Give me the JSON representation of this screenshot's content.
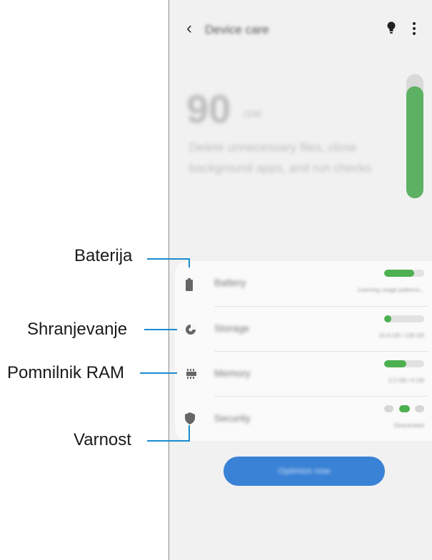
{
  "screen": {
    "title": "Device care",
    "score": "90",
    "score_unit": "/100",
    "description": "Delete unnecessary files, close background apps, and run checks",
    "score_level": 0.9,
    "optimize_label": "Optimize now"
  },
  "icons": {
    "back": "back-chevron-icon",
    "bulb": "lightbulb-icon",
    "more": "more-options-icon"
  },
  "colors": {
    "accent": "#3a82d6",
    "good": "#4caf50",
    "callout": "#1a8ccf"
  },
  "items": [
    {
      "label": "Battery",
      "sub": "Learning usage patterns...",
      "level": 0.75,
      "icon": "battery-icon"
    },
    {
      "label": "Storage",
      "sub": "20.6 GB / 128 GB",
      "level": 0.17,
      "icon": "storage-pie-icon"
    },
    {
      "label": "Memory",
      "sub": "2.2 GB / 6 GB",
      "level": 0.55,
      "icon": "memory-chip-icon"
    },
    {
      "label": "Security",
      "sub": "Deactivated",
      "icon": "shield-icon"
    }
  ],
  "callouts": {
    "battery": "Baterija",
    "storage": "Shranjevanje",
    "memory": "Pomnilnik RAM",
    "security": "Varnost"
  }
}
